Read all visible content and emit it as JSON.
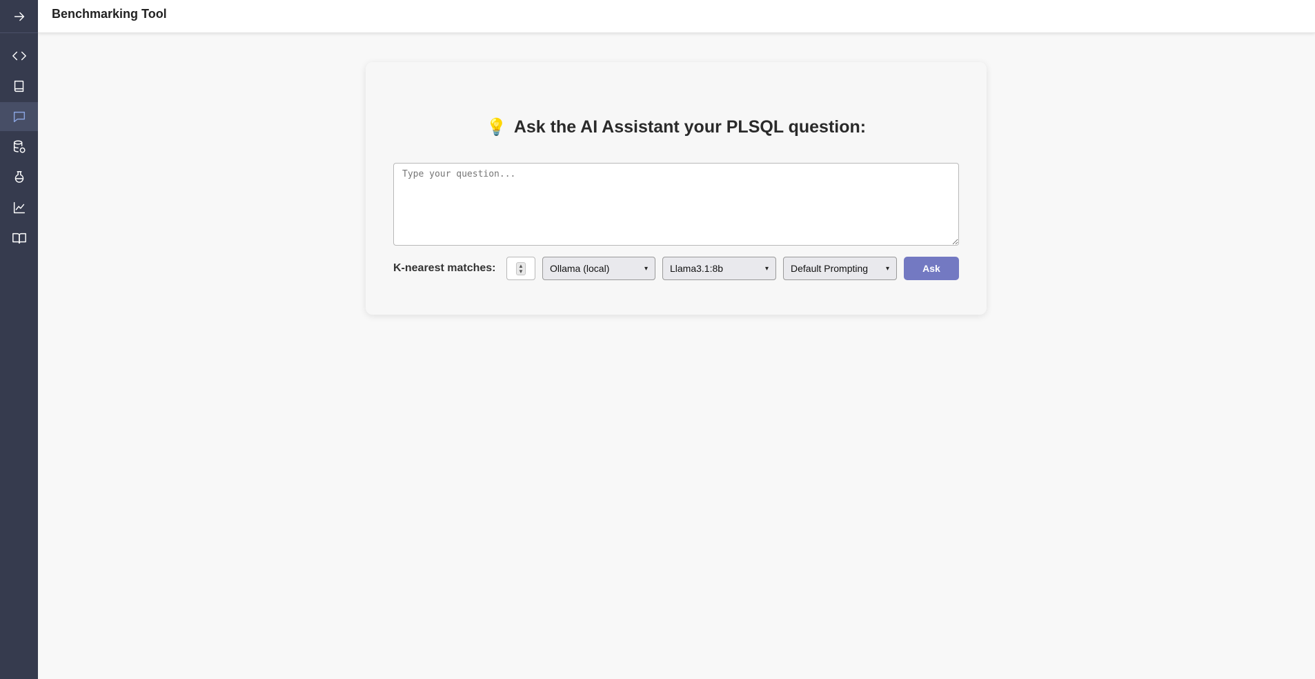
{
  "app": {
    "title": "Benchmarking Tool"
  },
  "sidebar": {
    "toggle": {
      "icon": "arrow-right-icon"
    },
    "items": [
      {
        "icon": "code-icon",
        "active": false
      },
      {
        "icon": "book-icon",
        "active": false
      },
      {
        "icon": "chat-icon",
        "active": true
      },
      {
        "icon": "database-icon",
        "active": false
      },
      {
        "icon": "flask-icon",
        "active": false
      },
      {
        "icon": "chart-line-icon",
        "active": false
      },
      {
        "icon": "open-book-icon",
        "active": false
      }
    ]
  },
  "main": {
    "heading_emoji": "💡",
    "heading": "Ask the AI Assistant your PLSQL question:",
    "question": {
      "value": "",
      "placeholder": "Type your question..."
    },
    "k_label": "K-nearest matches:",
    "k_value": "",
    "provider": {
      "selected": "Ollama (local)"
    },
    "model": {
      "selected": "Llama3.1:8b"
    },
    "prompting": {
      "selected": "Default Prompting"
    },
    "ask_label": "Ask"
  },
  "colors": {
    "sidebar_bg": "#363b4e",
    "active_icon": "#8aa4e0",
    "ask_button": "#7379c2"
  }
}
